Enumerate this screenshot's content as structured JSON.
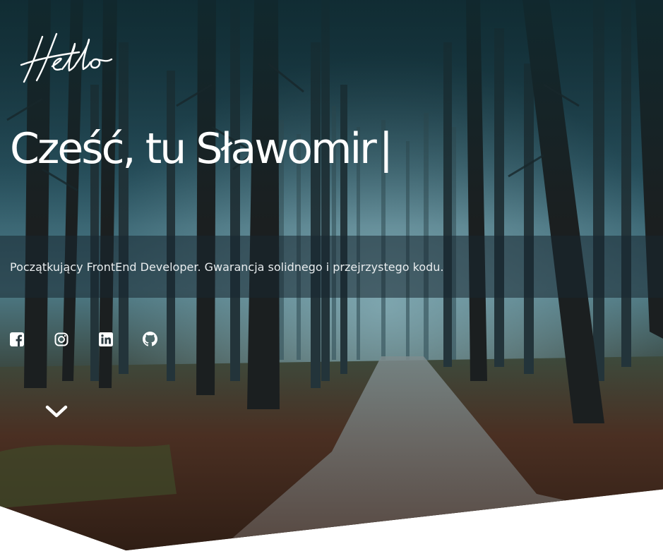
{
  "hero": {
    "logo_text": "Hello",
    "headline": "Cześć, tu Sławomir",
    "cursor": "|",
    "tagline": "Początkujący FrontEnd Developer. Gwarancja solidnego i przejrzystego kodu."
  },
  "social_links": [
    {
      "icon": "facebook-icon"
    },
    {
      "icon": "instagram-icon"
    },
    {
      "icon": "linkedin-icon"
    },
    {
      "icon": "github-icon"
    }
  ],
  "scroll_icon": "chevron-down-icon",
  "colors": {
    "text": "#ffffff",
    "overlay_band": "#182630",
    "page_background": "#ffffff"
  }
}
